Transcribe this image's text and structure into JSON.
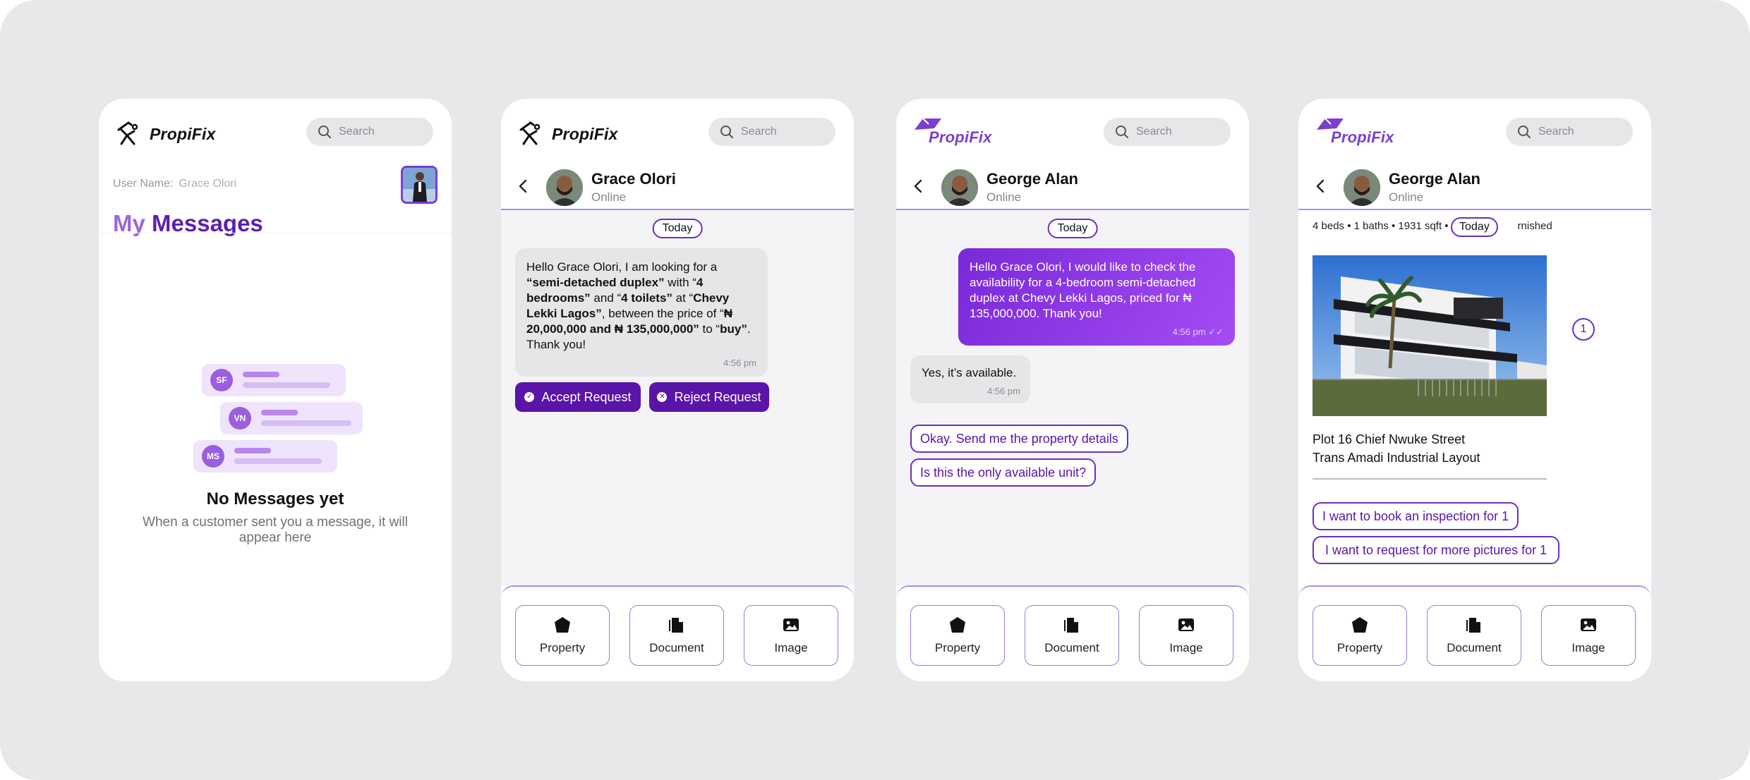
{
  "brand": {
    "name": "PropiFix"
  },
  "search": {
    "placeholder": "Search"
  },
  "screen1": {
    "username_label": "User Name:",
    "username_value": "Grace Olori",
    "title_my": "My",
    "title_messages": "Messages",
    "avatars": [
      "SF",
      "VN",
      "MS"
    ],
    "empty_title": "No Messages yet",
    "empty_sub": "When a customer sent you a message, it will appear here"
  },
  "screen2": {
    "contact_name": "Grace Olori",
    "contact_status": "Online",
    "day_label": "Today",
    "message": {
      "part1": "Hello Grace Olori, I am looking for a ",
      "b1": "“semi-detached duplex”",
      "part2": " with “",
      "b2": "4 bedrooms”",
      "part3": " and “",
      "b3": "4 toilets”",
      "part4": " at “",
      "b4": "Chevy Lekki Lagos”",
      "part5": ", between the price of “",
      "b5": "₦ 20,000,000 and ₦ 135,000,000”",
      "part6": " to “",
      "b6": "buy”",
      "part7": ". Thank you!",
      "time": "4:56 pm"
    },
    "accept_label": "Accept Request",
    "reject_label": "Reject Request"
  },
  "screen3": {
    "contact_name": "George Alan",
    "contact_status": "Online",
    "day_label": "Today",
    "out_message": "Hello Grace Olori, I would like to check the availability for a 4-bedroom semi-detached duplex at Chevy Lekki Lagos, priced for ₦ 135,000,000. Thank you!",
    "out_time": "4:56 pm",
    "in_message": "Yes, it’s available.",
    "in_time": "4:56 pm",
    "quick_replies": [
      "Okay. Send me the property details",
      "Is this the only available unit?"
    ]
  },
  "screen4": {
    "contact_name": "George Alan",
    "contact_status": "Online",
    "specs_left": "4 beds • 1 baths • 1931 sqft •",
    "specs_right": "rnished",
    "day_label": "Today",
    "image_count": "1",
    "address_line1": "Plot 16 Chief Nwuke Street",
    "address_line2": "Trans Amadi Industrial Layout",
    "quick_replies": [
      "I want to book an inspection for 1",
      "I want to request for more pictures for 1"
    ]
  },
  "toolbar": {
    "property": "Property",
    "document": "Document",
    "image": "Image"
  },
  "colors": {
    "accent": "#5a14a8",
    "accent_light": "#9a68d8",
    "chat_bg": "#f4f4f6",
    "canvas": "#e7e8ea"
  }
}
